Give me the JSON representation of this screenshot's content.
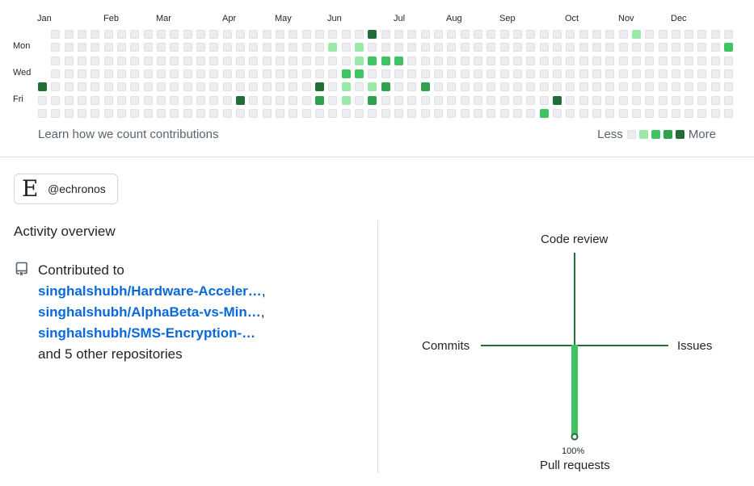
{
  "calendar": {
    "months": [
      {
        "label": "Jan",
        "col": 0
      },
      {
        "label": "Feb",
        "col": 5
      },
      {
        "label": "Mar",
        "col": 9
      },
      {
        "label": "Apr",
        "col": 14
      },
      {
        "label": "May",
        "col": 18
      },
      {
        "label": "Jun",
        "col": 22
      },
      {
        "label": "Jul",
        "col": 27
      },
      {
        "label": "Aug",
        "col": 31
      },
      {
        "label": "Sep",
        "col": 35
      },
      {
        "label": "Oct",
        "col": 40
      },
      {
        "label": "Nov",
        "col": 44
      },
      {
        "label": "Dec",
        "col": 48
      }
    ],
    "day_labels": [
      {
        "label": "Mon",
        "row": 1
      },
      {
        "label": "Wed",
        "row": 3
      },
      {
        "label": "Fri",
        "row": 5
      }
    ],
    "weeks": 53,
    "first_week_start_row": 4,
    "last_week_end_row": 6,
    "active_cells": [
      {
        "week": 0,
        "day": 4,
        "level": 4
      },
      {
        "week": 15,
        "day": 5,
        "level": 4
      },
      {
        "week": 21,
        "day": 4,
        "level": 4
      },
      {
        "week": 21,
        "day": 5,
        "level": 3
      },
      {
        "week": 22,
        "day": 1,
        "level": 1
      },
      {
        "week": 23,
        "day": 3,
        "level": 2
      },
      {
        "week": 23,
        "day": 4,
        "level": 1
      },
      {
        "week": 23,
        "day": 5,
        "level": 1
      },
      {
        "week": 24,
        "day": 1,
        "level": 1
      },
      {
        "week": 24,
        "day": 2,
        "level": 1
      },
      {
        "week": 24,
        "day": 3,
        "level": 2
      },
      {
        "week": 25,
        "day": 0,
        "level": 4
      },
      {
        "week": 25,
        "day": 2,
        "level": 2
      },
      {
        "week": 25,
        "day": 4,
        "level": 1
      },
      {
        "week": 25,
        "day": 5,
        "level": 3
      },
      {
        "week": 26,
        "day": 2,
        "level": 2
      },
      {
        "week": 26,
        "day": 4,
        "level": 3
      },
      {
        "week": 27,
        "day": 2,
        "level": 2
      },
      {
        "week": 29,
        "day": 4,
        "level": 3
      },
      {
        "week": 38,
        "day": 6,
        "level": 2
      },
      {
        "week": 39,
        "day": 5,
        "level": 4
      },
      {
        "week": 45,
        "day": 0,
        "level": 1
      },
      {
        "week": 52,
        "day": 1,
        "level": 2
      }
    ],
    "level_colors": [
      "#ebedf0",
      "#9be9a8",
      "#40c463",
      "#30a14e",
      "#216e39"
    ],
    "learn_link": "Learn how we count contributions",
    "legend_less": "Less",
    "legend_more": "More"
  },
  "org": {
    "logo_text": "E",
    "name": "@echronos"
  },
  "activity": {
    "title": "Activity overview",
    "contributed_to": "Contributed to",
    "repos": [
      "singhalshubh/Hardware-Acceler…",
      "singhalshubh/AlphaBeta-vs-Min…",
      "singhalshubh/SMS-Encryption-…"
    ],
    "separator": ",",
    "others": "and 5 other repositories",
    "repo_icon": "repo-icon"
  },
  "overview_chart": {
    "labels": {
      "code_review": "Code review",
      "commits": "Commits",
      "issues": "Issues",
      "pull_requests": "Pull requests"
    },
    "percentages": {
      "code_review": 0,
      "commits": 0,
      "issues": 0,
      "pull_requests": 100
    },
    "pull_requests_pct_label": "100%",
    "axis_color": "#216e39",
    "fill_color": "#40c463"
  }
}
